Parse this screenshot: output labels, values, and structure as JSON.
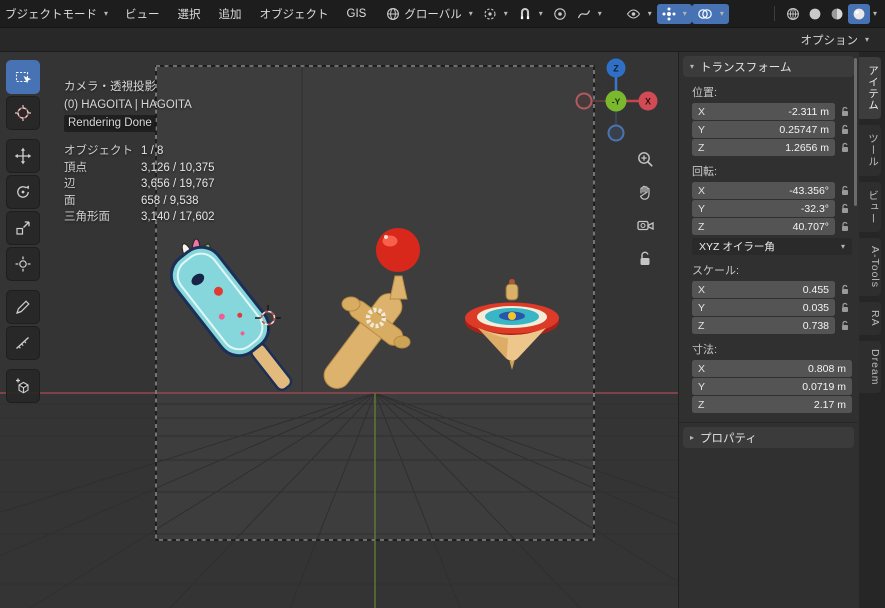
{
  "colors": {
    "accent": "#4772b3",
    "axis_x": "#c4474f",
    "axis_y": "#7ab82e",
    "axis_z": "#2f6fc6",
    "field_bg": "#545454",
    "viewport_bg": "#3d3d3d",
    "topbar_bg": "#1d1d1d"
  },
  "icons": {
    "caret_down": "▾",
    "caret_right": "▸"
  },
  "header": {
    "mode": "ブジェクトモード",
    "menus": [
      "ビュー",
      "選択",
      "追加",
      "オブジェクト",
      "GIS"
    ],
    "orientation": "グローバル",
    "options": "オプション"
  },
  "axes": {
    "x": "X",
    "y": "Y",
    "z": "Z"
  },
  "viewport": {
    "view_label": "カメラ・透視投影",
    "object_label": "(0) HAGOITA | HAGOITA",
    "render_status": "Rendering Done",
    "stats": [
      {
        "label": "オブジェクト",
        "value": "1 / 8"
      },
      {
        "label": "頂点",
        "value": "3,126 / 10,375"
      },
      {
        "label": "辺",
        "value": "3,656 / 19,767"
      },
      {
        "label": "面",
        "value": "658 / 9,538"
      },
      {
        "label": "三角形面",
        "value": "3,140 / 17,602"
      }
    ],
    "gizmo": {
      "z": "Z",
      "y": "-Y",
      "x": "X"
    }
  },
  "panel": {
    "transform_title": "トランスフォーム",
    "location_label": "位置:",
    "location": {
      "x": "-2.311 m",
      "y": "0.25747 m",
      "z": "1.2656 m"
    },
    "rotation_label": "回転:",
    "rotation": {
      "x": "-43.356°",
      "y": "-32.3°",
      "z": "40.707°"
    },
    "rotation_mode": "XYZ オイラー角",
    "scale_label": "スケール:",
    "scale": {
      "x": "0.455",
      "y": "0.035",
      "z": "0.738"
    },
    "dimensions_label": "寸法:",
    "dimensions": {
      "x": "0.808 m",
      "y": "0.0719 m",
      "z": "2.17 m"
    },
    "properties_title": "プロパティ"
  },
  "tabs": [
    {
      "label": "アイテム",
      "active": true
    },
    {
      "label": "ツール",
      "active": false
    },
    {
      "label": "ビュー",
      "active": false
    },
    {
      "label": "A-Tools",
      "active": false
    },
    {
      "label": "RA",
      "active": false
    },
    {
      "label": "Dream",
      "active": false
    }
  ]
}
